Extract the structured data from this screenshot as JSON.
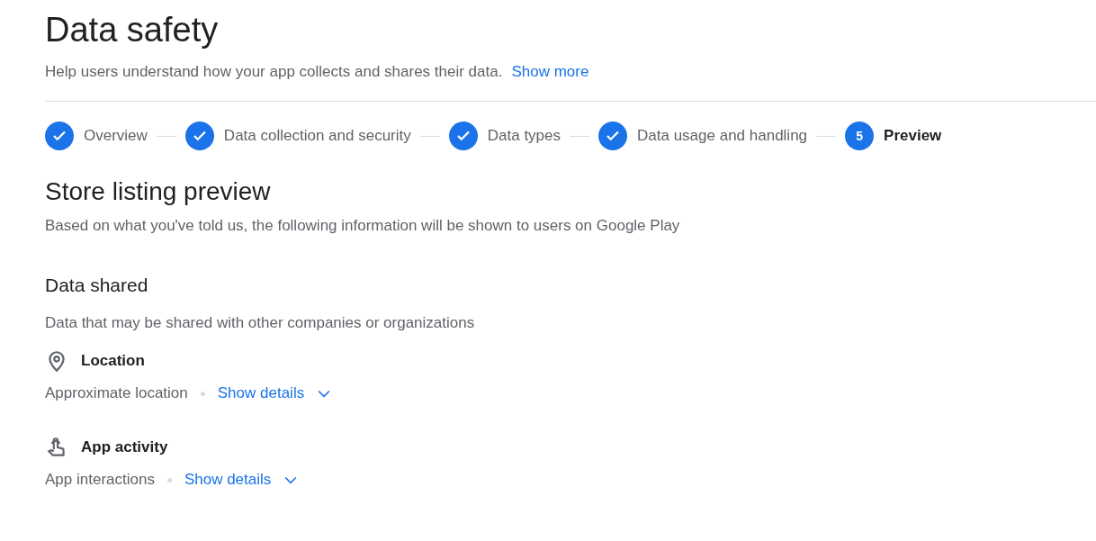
{
  "page": {
    "title": "Data safety",
    "description": "Help users understand how your app collects and shares their data.",
    "show_more": "Show more"
  },
  "steps": [
    {
      "label": "Overview",
      "completed": true
    },
    {
      "label": "Data collection and security",
      "completed": true
    },
    {
      "label": "Data types",
      "completed": true
    },
    {
      "label": "Data usage and handling",
      "completed": true
    },
    {
      "label": "Preview",
      "completed": false,
      "number": "5"
    }
  ],
  "preview": {
    "title": "Store listing preview",
    "description": "Based on what you've told us, the following information will be shown to users on Google Play"
  },
  "section": {
    "title": "Data shared",
    "description": "Data that may be shared with other companies or organizations",
    "categories": [
      {
        "kind": "location",
        "name": "Location",
        "types": "Approximate location",
        "action": "Show details",
        "expanded": false
      },
      {
        "kind": "app-activity",
        "name": "App activity",
        "types": "App interactions",
        "action": "Show details",
        "expanded": false
      }
    ]
  }
}
